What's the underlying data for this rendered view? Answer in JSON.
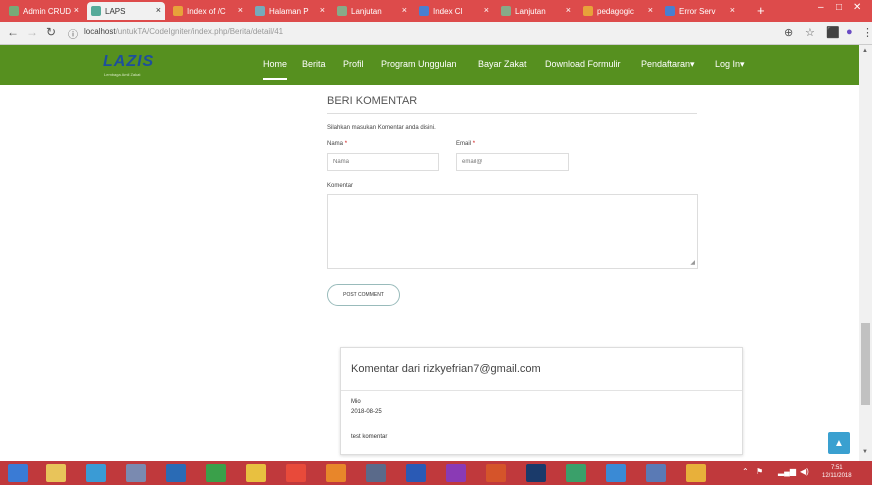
{
  "browser": {
    "tabs": [
      {
        "label": "Admin CRUD",
        "color": "#7a7"
      },
      {
        "label": "LAPS",
        "color": "#5a9"
      },
      {
        "label": "Index of /C",
        "color": "#e8a23a"
      },
      {
        "label": "Halaman P",
        "color": "#7ab"
      },
      {
        "label": "Lanjutan",
        "color": "#8a8"
      },
      {
        "label": "Index Cl",
        "color": "#4a7fd0"
      },
      {
        "label": "Lanjutan",
        "color": "#8a8"
      },
      {
        "label": "pedagogic",
        "color": "#e8a23a"
      },
      {
        "label": "Error Serv",
        "color": "#4a7fd0"
      }
    ],
    "tab_close_glyph": "×",
    "new_tab_glyph": "+",
    "url_host": "localhost",
    "url_path": "/untukTA/CodeIgniter/index.php/Berita/detail/41"
  },
  "site": {
    "logo": "LAZIS",
    "logo_tagline": "Lembaga Amil Zakat",
    "menu": [
      "Home",
      "Berita",
      "Profil",
      "Program Unggulan",
      "Bayar Zakat",
      "Download Formulir",
      "Pendaftaran▾",
      "Log In▾"
    ]
  },
  "comment_form": {
    "title": "BERI KOMENTAR",
    "hint": "Silahkan masukan Komentar anda disini.",
    "name_label": "Nama",
    "name_placeholder": "Nama",
    "email_label": "Email",
    "email_placeholder": "email@",
    "required_mark": "*",
    "comment_label": "Komentar",
    "submit_label": "POST COMMENT"
  },
  "comment": {
    "heading": "Komentar dari rizkyefrian7@gmail.com",
    "name": "Mio",
    "date": "2018-08-25",
    "text": "test komentar"
  },
  "taskbar": {
    "apps": [
      {
        "name": "start",
        "color": "#3a7bd5"
      },
      {
        "name": "file-explorer",
        "color": "#e8c45a"
      },
      {
        "name": "ie",
        "color": "#3a9bd5"
      },
      {
        "name": "app4",
        "color": "#7a8ab0"
      },
      {
        "name": "outlook",
        "color": "#2a6bb5"
      },
      {
        "name": "app6",
        "color": "#3aa04a"
      },
      {
        "name": "chrome",
        "color": "#e8c040"
      },
      {
        "name": "app8",
        "color": "#e84a3a"
      },
      {
        "name": "firefox",
        "color": "#e8862a"
      },
      {
        "name": "mail",
        "color": "#5a6a8a"
      },
      {
        "name": "word",
        "color": "#2a5ab5"
      },
      {
        "name": "onenote",
        "color": "#8a3ab5"
      },
      {
        "name": "powerpoint",
        "color": "#d5542a"
      },
      {
        "name": "photoshop",
        "color": "#1a3a6a"
      },
      {
        "name": "app15",
        "color": "#3aa06a"
      },
      {
        "name": "app16",
        "color": "#3a8ad5"
      },
      {
        "name": "app17",
        "color": "#5a7ab5"
      },
      {
        "name": "app18",
        "color": "#e8b03a"
      }
    ],
    "clock_time": "7:51",
    "clock_date": "12/11/2018"
  },
  "colors": {
    "navbar": "#56901f",
    "tabstrip": "#dd4b4b",
    "taskbar": "#c0393c",
    "back_to_top": "#3aa0d0"
  }
}
